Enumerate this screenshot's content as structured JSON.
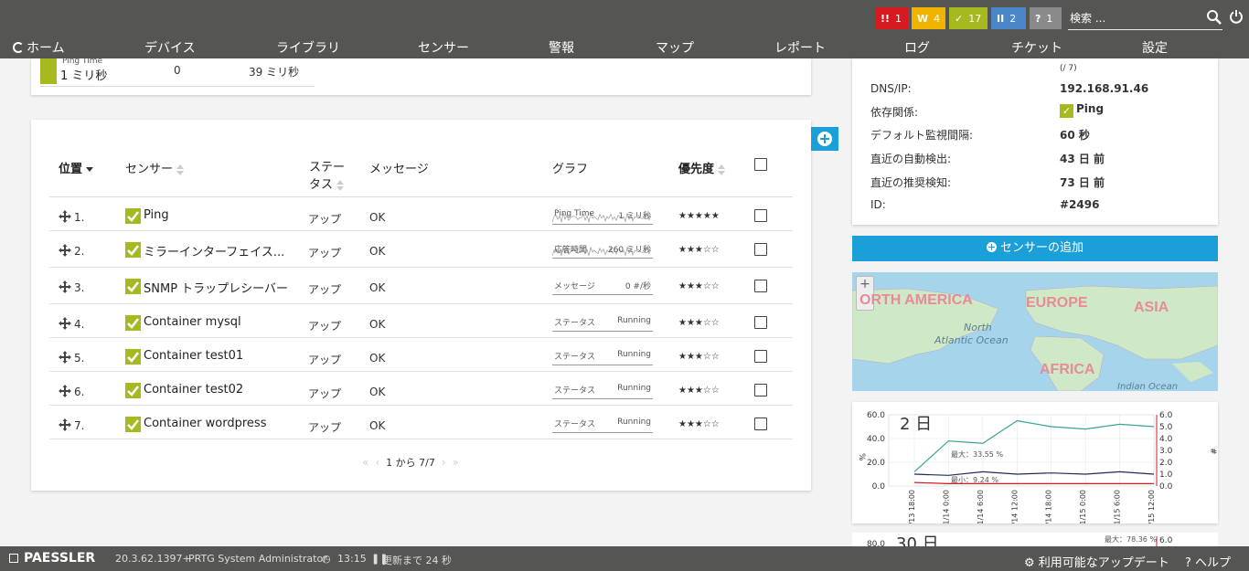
{
  "alerts": [
    {
      "icon": "!!",
      "count": "1",
      "color": "#d71920"
    },
    {
      "icon": "W",
      "count": "4",
      "color": "#f0b400"
    },
    {
      "icon": "✓",
      "count": "17",
      "color": "#a6b91e"
    },
    {
      "icon": "II",
      "count": "2",
      "color": "#4a86c8"
    },
    {
      "icon": "?",
      "count": "1",
      "color": "#8a8a8a"
    }
  ],
  "search": {
    "placeholder": "検索 ..."
  },
  "nav": [
    "ホーム",
    "デバイス",
    "ライブラリ",
    "センサー",
    "警報",
    "マップ",
    "レポート",
    "ログ",
    "チケット",
    "設定"
  ],
  "top_sensor": {
    "label": "Ping Time",
    "value": "1 ミリ秒",
    "col1": "0",
    "col2": "39 ミリ秒"
  },
  "table": {
    "headers": {
      "position": "位置",
      "sensor": "センサー",
      "status": "ステータス",
      "message": "メッセージ",
      "graph": "グラフ",
      "priority": "優先度"
    },
    "rows": [
      {
        "num": "1.",
        "name": "Ping",
        "status": "アップ",
        "message": "OK",
        "graph_label": "Ping Time",
        "graph_value": "1 ミリ秒",
        "graph_type": "spark",
        "stars": "★★★★★"
      },
      {
        "num": "2.",
        "name": "ミラーインターフェイス...",
        "status": "アップ",
        "message": "OK",
        "graph_label": "応答時間",
        "graph_value": "260 ミリ秒",
        "graph_type": "spark",
        "stars": "★★★☆☆"
      },
      {
        "num": "3.",
        "name": "SNMP トラップレシーバー",
        "status": "アップ",
        "message": "OK",
        "graph_label": "メッセージ",
        "graph_value": "0 #/秒",
        "graph_type": "flat",
        "stars": "★★★☆☆"
      },
      {
        "num": "4.",
        "name": "Container mysql",
        "status": "アップ",
        "message": "OK",
        "graph_label": "ステータス",
        "graph_value": "Running",
        "graph_type": "flat",
        "stars": "★★★☆☆"
      },
      {
        "num": "5.",
        "name": "Container test01",
        "status": "アップ",
        "message": "OK",
        "graph_label": "ステータス",
        "graph_value": "Running",
        "graph_type": "flat",
        "stars": "★★★☆☆"
      },
      {
        "num": "6.",
        "name": "Container test02",
        "status": "アップ",
        "message": "OK",
        "graph_label": "ステータス",
        "graph_value": "Running",
        "graph_type": "flat",
        "stars": "★★★☆☆"
      },
      {
        "num": "7.",
        "name": "Container wordpress",
        "status": "アップ",
        "message": "OK",
        "graph_label": "ステータス",
        "graph_value": "Running",
        "graph_type": "flat",
        "stars": "★★★☆☆"
      }
    ],
    "pager": "1 から 7/7"
  },
  "info": {
    "partial": "(/ 7)",
    "rows": [
      {
        "label": "DNS/IP:",
        "value": "192.168.91.46"
      },
      {
        "label": "依存関係:",
        "value": "Ping"
      },
      {
        "label": "デフォルト監視間隔:",
        "value": "60 秒"
      },
      {
        "label": "直近の自動検出:",
        "value": "43 日 前"
      },
      {
        "label": "直近の推奨検知:",
        "value": "73 日 前"
      },
      {
        "label": "ID:",
        "value": "#2496"
      }
    ]
  },
  "add_sensor_label": "センサーの追加",
  "map": {
    "labels": [
      "ORTH AMERICA",
      "EUROPE",
      "ASIA",
      "AFRICA"
    ],
    "sea": [
      "North",
      "Atlantic Ocean",
      "Indian Ocean"
    ]
  },
  "chart_data": [
    {
      "type": "line",
      "title": "2 日",
      "ylabel_left": "%",
      "ylabel_right": "#",
      "ylim_left": [
        0,
        60
      ],
      "ylim_right": [
        0,
        6
      ],
      "yticks_left": [
        "0.0",
        "20.0",
        "40.0",
        "60.0"
      ],
      "yticks_right": [
        "0.0",
        "1.0",
        "2.0",
        "3.0",
        "4.0",
        "5.0",
        "6.0"
      ],
      "x": [
        "01/13 18:00",
        "01/14 0:00",
        "01/14 6:00",
        "01/14 12:00",
        "01/14 18:00",
        "01/15 0:00",
        "01/15 6:00",
        "01/15 12:00"
      ],
      "series": [
        {
          "color": "#3aa58f",
          "values": [
            12,
            38,
            36,
            55,
            50,
            48,
            52,
            50
          ]
        },
        {
          "color": "#1f2d5a",
          "values": [
            10,
            9,
            12,
            10,
            11,
            10,
            12,
            10
          ]
        },
        {
          "color": "#d71920",
          "values": [
            0.3,
            0.2,
            0.2,
            0.2,
            0.2,
            0.2,
            0.2,
            0.2
          ]
        }
      ],
      "annotations": [
        "最大：33.55 %",
        "最小：9.24 %"
      ]
    },
    {
      "type": "line",
      "title": "30 日",
      "yticks_left": [
        "80.0"
      ],
      "yticks_right": [
        "6.0"
      ],
      "annotations": [
        "最大：78.36 %"
      ]
    }
  ],
  "footer": {
    "brand": "PAESSLER",
    "version": "20.3.62.1397+",
    "user": "PRTG System Administrator",
    "time": "13:15",
    "refresh": "更新まで 24 秒",
    "updates": "利用可能なアップデート",
    "help": "ヘルプ"
  }
}
